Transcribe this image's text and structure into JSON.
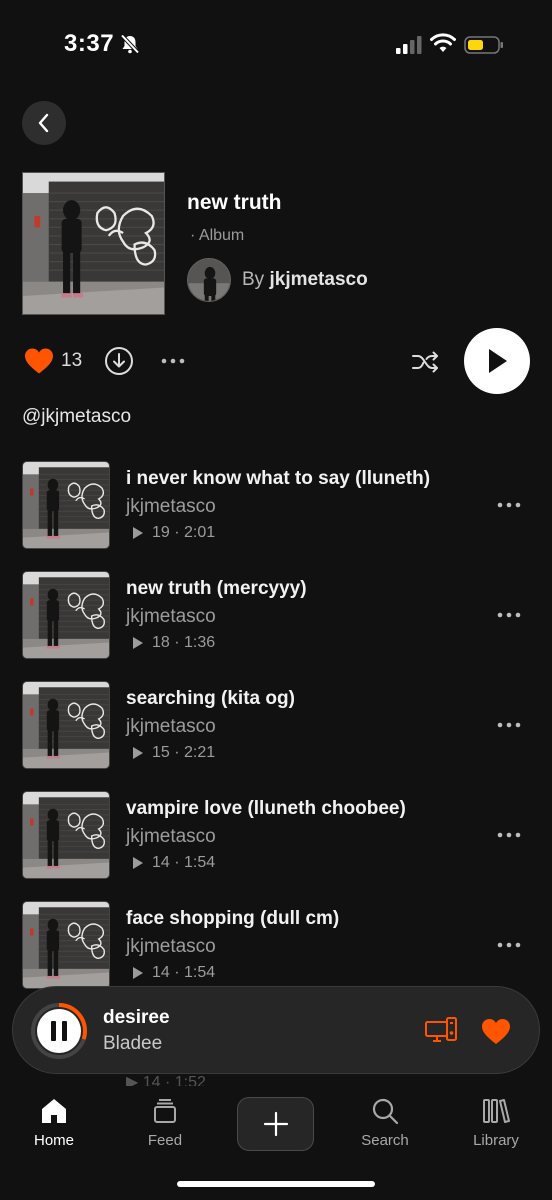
{
  "status": {
    "time": "3:37"
  },
  "album": {
    "title": "new truth",
    "type": "· Album",
    "by_prefix": "By",
    "artist": "jkjmetasco",
    "likes": "13",
    "handle": "@jkjmetasco"
  },
  "tracks": [
    {
      "title": "i never know what to say (lluneth)",
      "artist": "jkjmetasco",
      "plays": "19",
      "duration": "2:01"
    },
    {
      "title": "new truth (mercyyy)",
      "artist": "jkjmetasco",
      "plays": "18",
      "duration": "1:36"
    },
    {
      "title": "searching (kita og)",
      "artist": "jkjmetasco",
      "plays": "15",
      "duration": "2:21"
    },
    {
      "title": "vampire love (lluneth choobee)",
      "artist": "jkjmetasco",
      "plays": "14",
      "duration": "1:54"
    },
    {
      "title": "face shopping (dull cm)",
      "artist": "jkjmetasco",
      "plays": "14",
      "duration": "1:54"
    }
  ],
  "ghost": "▶ 14 · 1:52",
  "now_playing": {
    "title": "desiree",
    "artist": "Bladee",
    "progress": 0.3
  },
  "nav": {
    "home": "Home",
    "feed": "Feed",
    "search": "Search",
    "library": "Library"
  },
  "colors": {
    "accent": "#ff5500",
    "background": "#111111"
  },
  "icons": [
    "back-icon",
    "heart-icon",
    "download-icon",
    "more-icon",
    "shuffle-icon",
    "play-icon",
    "pause-icon",
    "device-icon",
    "home-icon",
    "feed-icon",
    "plus-icon",
    "search-icon",
    "library-icon"
  ]
}
